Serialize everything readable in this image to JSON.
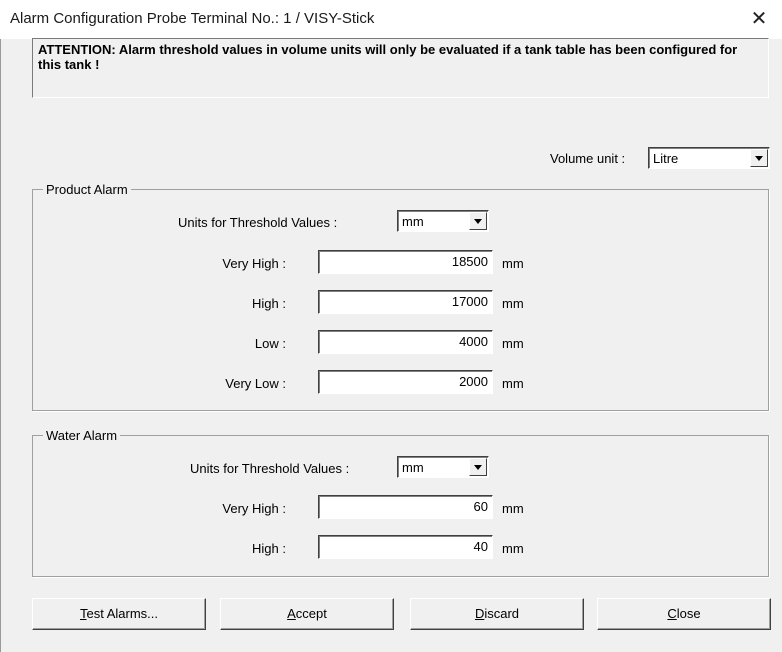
{
  "window": {
    "title": "Alarm Configuration Probe Terminal No.: 1 / VISY-Stick",
    "close_glyph": "✕"
  },
  "attention": "ATTENTION: Alarm threshold values in volume units will only be evaluated if a tank table has been configured for this tank !",
  "volume_unit": {
    "label": "Volume unit :",
    "value": "Litre"
  },
  "product_alarm": {
    "legend": "Product Alarm",
    "units_label": "Units for Threshold Values :",
    "units_value": "mm",
    "rows": [
      {
        "label": "Very High :",
        "value": "18500",
        "unit": "mm"
      },
      {
        "label": "High :",
        "value": "17000",
        "unit": "mm"
      },
      {
        "label": "Low :",
        "value": "4000",
        "unit": "mm"
      },
      {
        "label": "Very Low :",
        "value": "2000",
        "unit": "mm"
      }
    ]
  },
  "water_alarm": {
    "legend": "Water Alarm",
    "units_label": "Units for Threshold Values :",
    "units_value": "mm",
    "rows": [
      {
        "label": "Very High :",
        "value": "60",
        "unit": "mm"
      },
      {
        "label": "High :",
        "value": "40",
        "unit": "mm"
      }
    ]
  },
  "buttons": {
    "test": {
      "mnemonic": "T",
      "rest": "est Alarms..."
    },
    "accept": {
      "mnemonic": "A",
      "rest": "ccept"
    },
    "discard": {
      "mnemonic": "D",
      "rest": "iscard"
    },
    "close": {
      "mnemonic": "C",
      "rest": "lose"
    }
  }
}
